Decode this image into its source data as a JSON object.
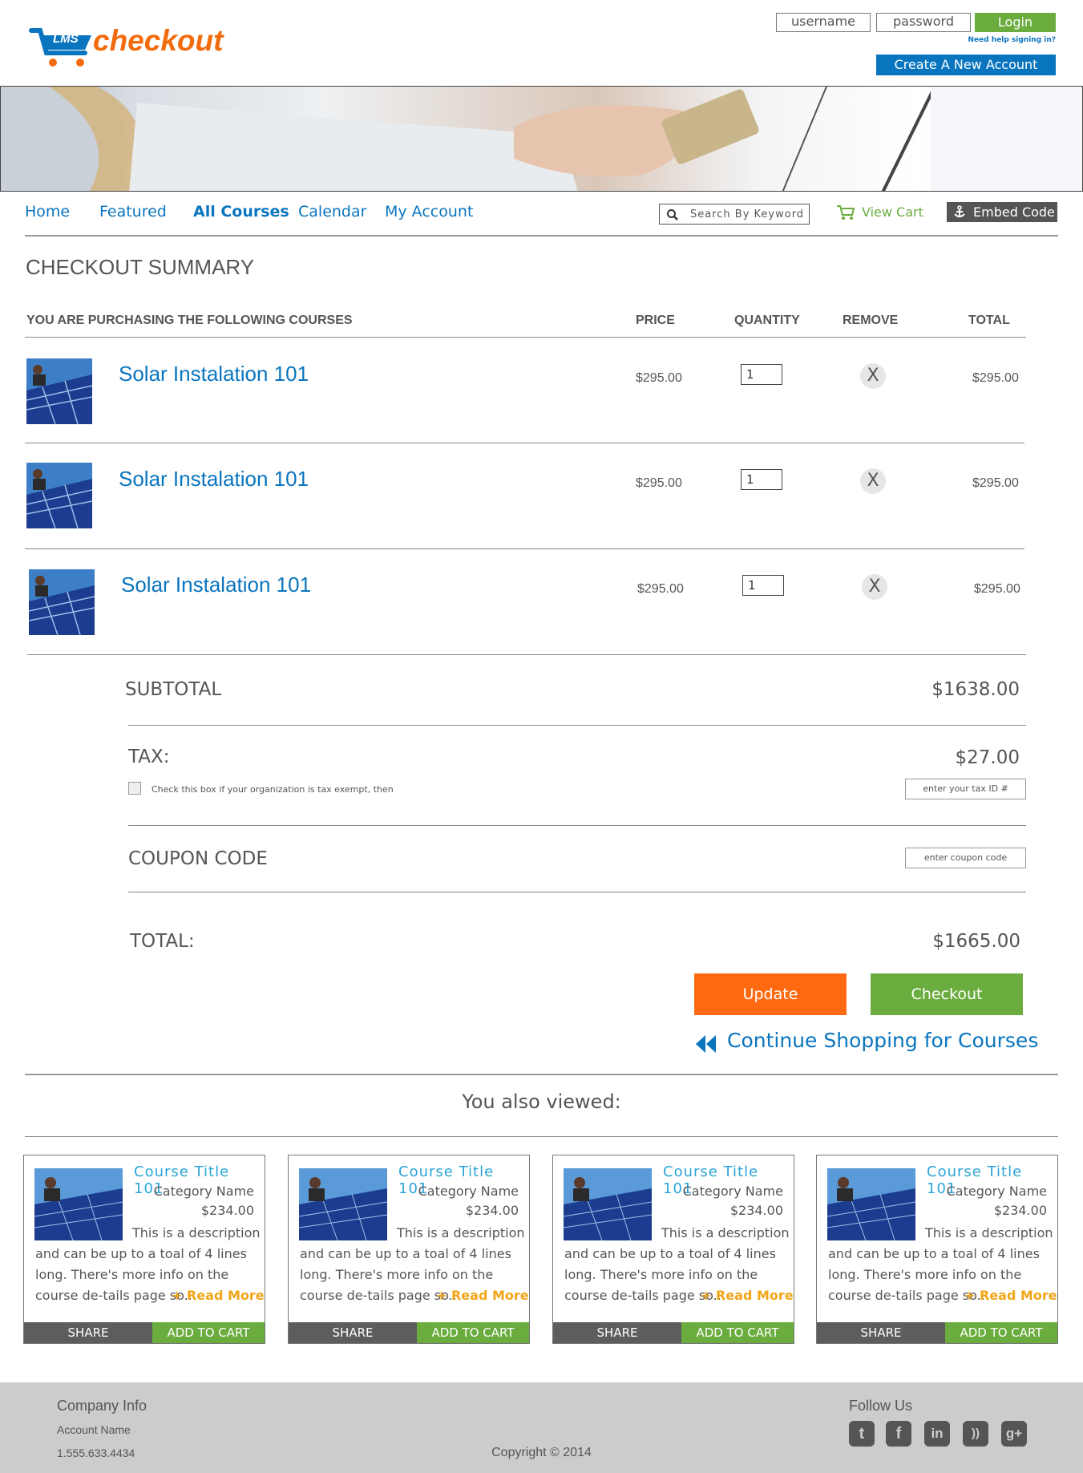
{
  "brand": {
    "logo_mark": "LMS",
    "logo_text": "checkout",
    "logo_color": "#f26c0d",
    "accent_blue": "#0a75bf",
    "accent_green": "#6aac3d",
    "accent_orange": "#ff6a10"
  },
  "auth": {
    "username_placeholder": "username",
    "password_placeholder": "password",
    "login_label": "Login",
    "help_link": "Need help signing in?",
    "create_account_label": "Create  A  New  Account"
  },
  "nav": {
    "items": [
      {
        "label": "Home"
      },
      {
        "label": "Featured"
      },
      {
        "label": "All Courses"
      },
      {
        "label": "Calendar"
      },
      {
        "label": "My Account"
      }
    ],
    "active": "All Courses",
    "search_placeholder": "Search By Keyword",
    "view_cart_label": "View Cart",
    "embed_code_label": "Embed Code"
  },
  "checkout": {
    "page_title": "CHECKOUT SUMMARY",
    "columns": {
      "courses": "YOU ARE PURCHASING THE FOLLOWING COURSES",
      "price": "PRICE",
      "quantity": "QUANTITY",
      "remove": "REMOVE",
      "total": "TOTAL"
    },
    "items": [
      {
        "title": "Solar Instalation 101",
        "price": "$295.00",
        "quantity": "1",
        "remove": "X",
        "total": "$295.00"
      },
      {
        "title": "Solar Instalation 101",
        "price": "$295.00",
        "quantity": "1",
        "remove": "X",
        "total": "$295.00"
      },
      {
        "title": "Solar Instalation 101",
        "price": "$295.00",
        "quantity": "1",
        "remove": "X",
        "total": "$295.00"
      }
    ],
    "subtotal_label": "SUBTOTAL",
    "subtotal_value": "$1638.00",
    "tax_label": "TAX:",
    "tax_value": "$27.00",
    "tax_exempt_text": "Check this box if your organization is tax exempt, then",
    "tax_id_placeholder": "enter your tax ID #",
    "coupon_label": "COUPON CODE",
    "coupon_placeholder": "enter coupon code",
    "total_label": "TOTAL:",
    "total_value": "$1665.00",
    "update_label": "Update",
    "checkout_label": "Checkout",
    "continue_label": "Continue Shopping for Courses"
  },
  "also_viewed": {
    "heading": "You also viewed:",
    "cards": [
      {
        "title": "Course Title 101",
        "category": "Category Name",
        "price": "$234.00",
        "desc_first": "This is a description",
        "desc_rest": "and can be up to a toal of 4 lines long. There's more info on the course de-tails page so...",
        "read_more": "+ Read More",
        "share": "SHARE",
        "add_to_cart": "ADD TO CART"
      },
      {
        "title": "Course Title 101",
        "category": "Category Name",
        "price": "$234.00",
        "desc_first": "This is a description",
        "desc_rest": "and can be up to a toal of 4 lines long. There's more info on the course de-tails page so...",
        "read_more": "+ Read More",
        "share": "SHARE",
        "add_to_cart": "ADD TO CART"
      },
      {
        "title": "Course Title 101",
        "category": "Category Name",
        "price": "$234.00",
        "desc_first": "This is a description",
        "desc_rest": "and can be up to a toal of 4 lines long. There's more info on the course de-tails page so...",
        "read_more": "+ Read More",
        "share": "SHARE",
        "add_to_cart": "ADD TO CART"
      },
      {
        "title": "Course Title 101",
        "category": "Category Name",
        "price": "$234.00",
        "desc_first": "This is a description",
        "desc_rest": "and can be up to a toal of 4 lines long. There's more info on the course de-tails page so...",
        "read_more": "+ Read More",
        "share": "SHARE",
        "add_to_cart": "ADD TO CART"
      }
    ]
  },
  "footer": {
    "company_heading": "Company Info",
    "account_name": "Account Name",
    "phone": "1.555.633.4434",
    "copyright": "Copyright © 2014",
    "follow_heading": "Follow Us",
    "social": [
      {
        "icon": "twitter-icon",
        "glyph": "t"
      },
      {
        "icon": "facebook-icon",
        "glyph": "f"
      },
      {
        "icon": "linkedin-icon",
        "glyph": "in"
      },
      {
        "icon": "rss-icon",
        "glyph": "))"
      },
      {
        "icon": "google-plus-icon",
        "glyph": "g+"
      }
    ]
  }
}
